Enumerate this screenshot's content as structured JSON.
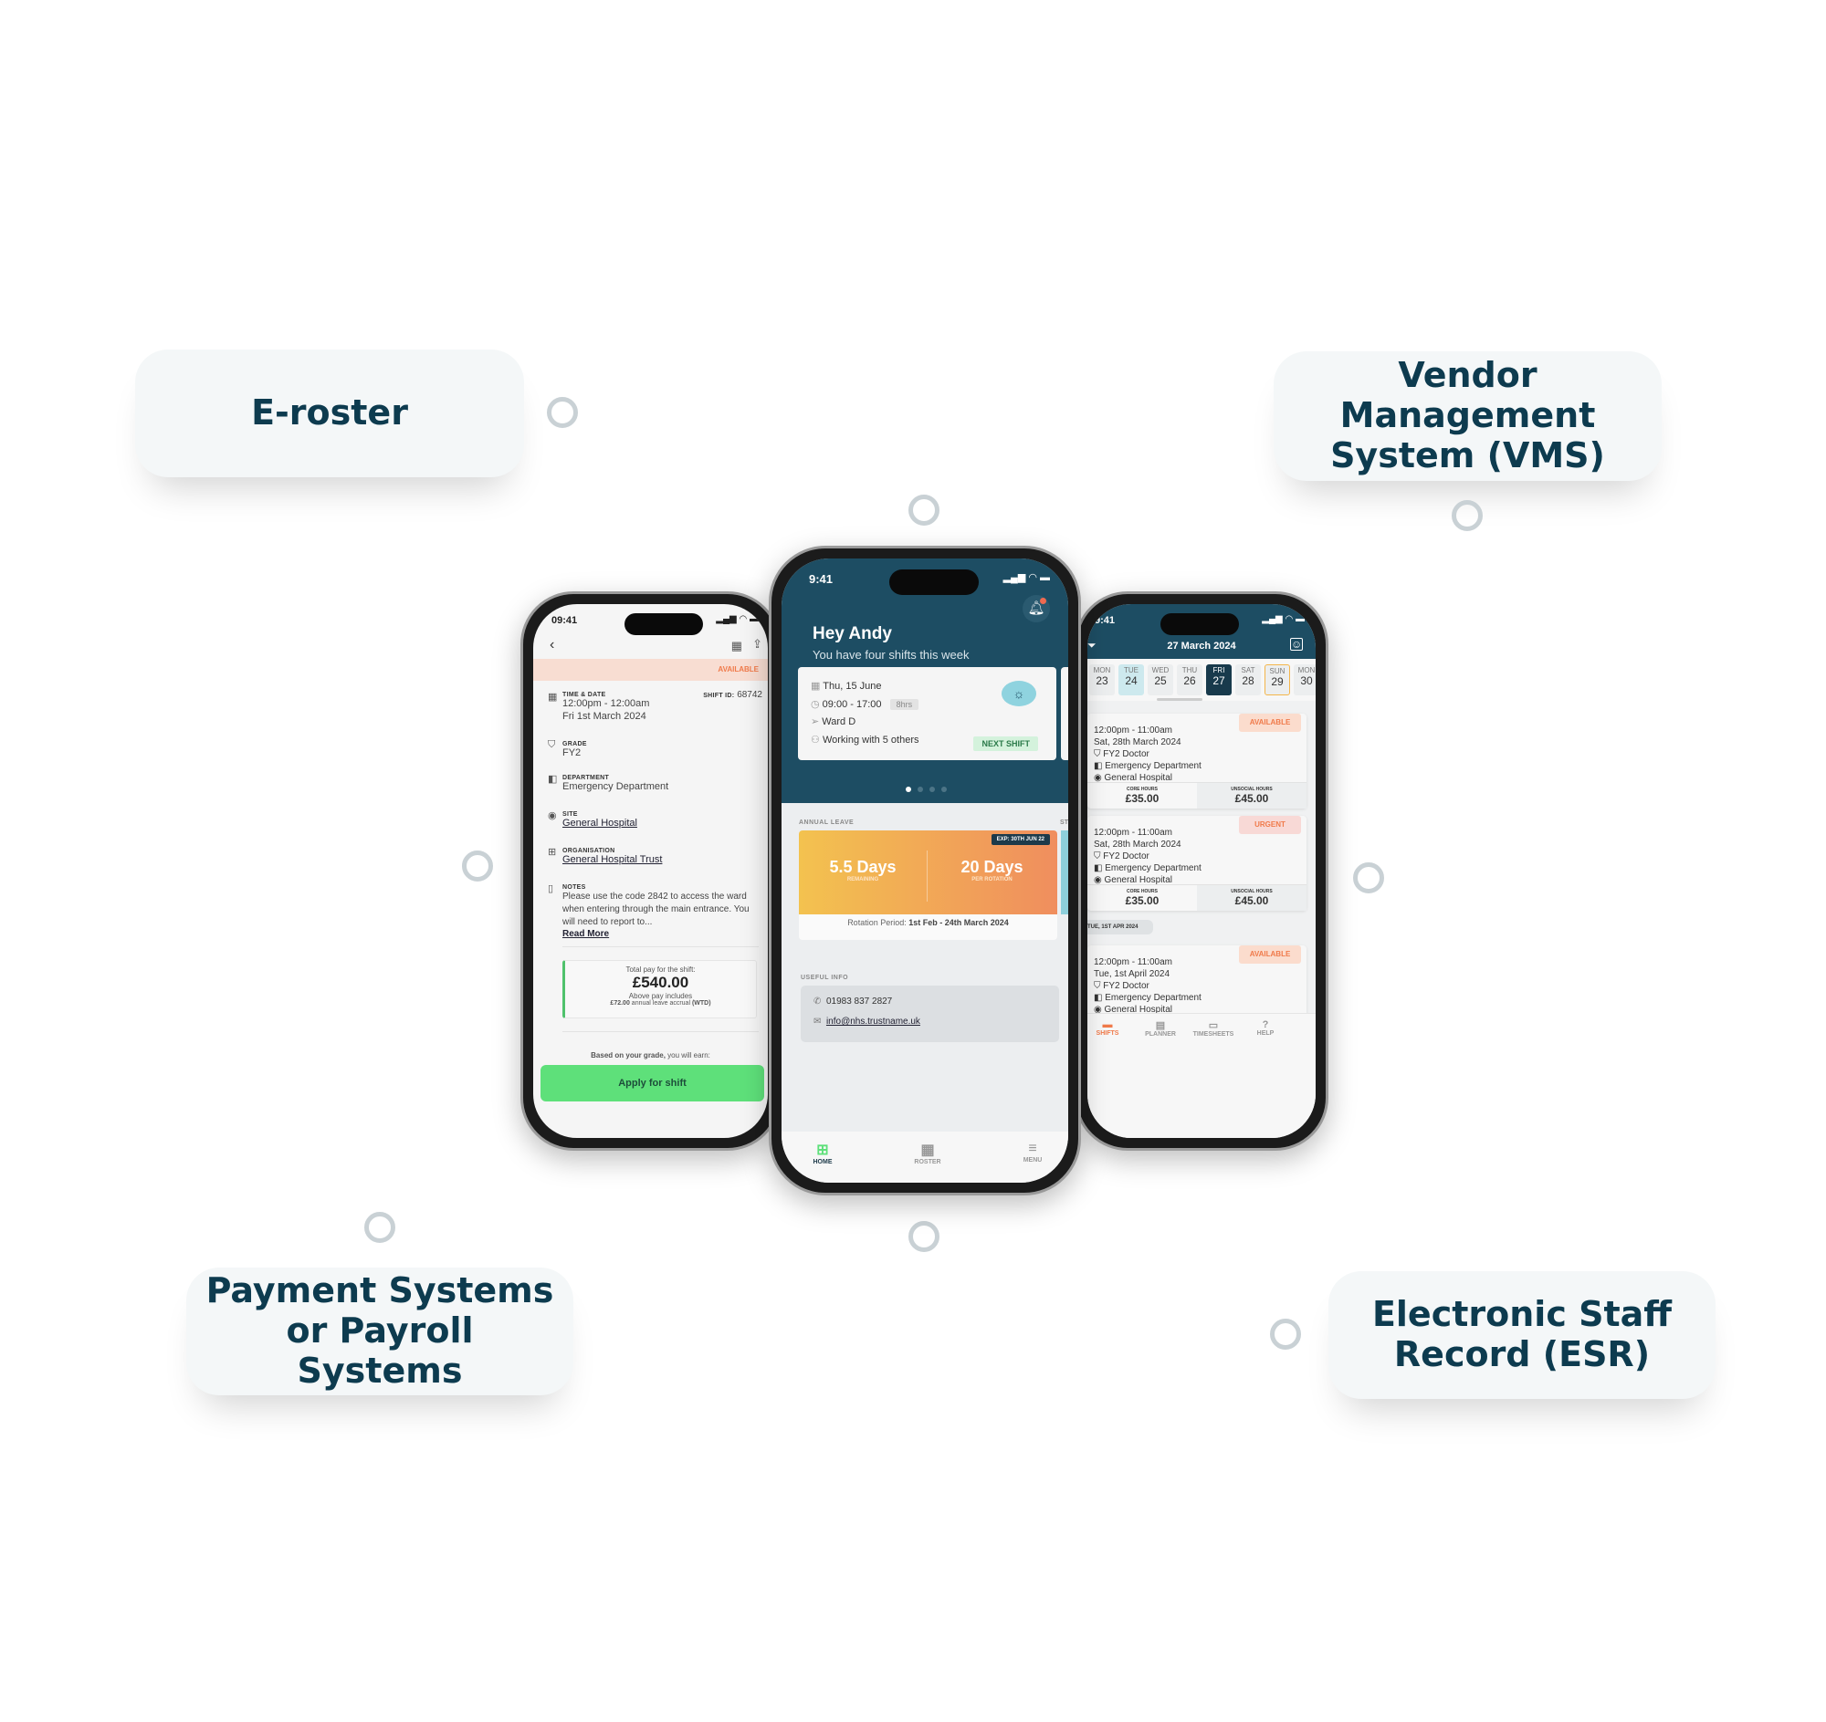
{
  "cards": {
    "eroster": "E-roster",
    "vms": "Vendor Management System (VMS)",
    "payment": "Payment Systems or Payroll Systems",
    "esr": "Electronic Staff Record (ESR)"
  },
  "colors": {
    "brand": "#0d3b4f",
    "header": "#1d4d63",
    "accent_green": "#5ee07a",
    "accent_orange": "#f07a4a"
  },
  "left_phone": {
    "time": "09:41",
    "status_badge": "AVAILABLE",
    "time_date_label": "TIME & DATE",
    "time_range": "12:00pm - 12:00am",
    "date": "Fri 1st March 2024",
    "shift_id_label": "SHIFT ID:",
    "shift_id": "68742",
    "grade_label": "GRADE",
    "grade": "FY2",
    "department_label": "DEPARTMENT",
    "department": "Emergency Department",
    "site_label": "SITE",
    "site": "General Hospital",
    "org_label": "ORGANISATION",
    "org": "General Hospital Trust",
    "notes_label": "NOTES",
    "notes": "Please use the code 2842 to access the ward when entering through the main entrance. You will need to report to...",
    "read_more": "Read More",
    "pay_title": "Total pay for the shift:",
    "pay_amount": "£540.00",
    "pay_includes": "Above pay includes",
    "pay_accrual_amount": "£72.00",
    "pay_accrual_text": "annual leave accrual",
    "pay_wtd": "(WTD)",
    "grade_earn_bold": "Based on your grade,",
    "grade_earn_rest": "you will earn:",
    "apply_button": "Apply for shift"
  },
  "center_phone": {
    "time": "9:41",
    "greeting": "Hey Andy",
    "subtitle": "You have four shifts this week",
    "next_shift": {
      "date": "Thu, 15 June",
      "time": "09:00 - 17:00",
      "duration": "8hrs",
      "ward": "Ward D",
      "team": "Working with 5 others",
      "badge": "NEXT SHIFT"
    },
    "carousel_pages": 4,
    "carousel_active": 1,
    "annual_leave_label": "ANNUAL LEAVE",
    "next_section_label": "ST",
    "leave": {
      "expiry": "EXP: 30TH JUN 22",
      "remaining": "5.5 Days",
      "remaining_label": "REMAINING",
      "per_rotation": "20 Days",
      "per_rotation_label": "PER ROTATION",
      "rotation_label": "Rotation Period:",
      "rotation_value": "1st Feb - 24th March 2024"
    },
    "useful_info_label": "USEFUL INFO",
    "phone": "01983 837 2827",
    "email": "info@nhs.trustname.uk",
    "nav": [
      {
        "label": "HOME",
        "active": true
      },
      {
        "label": "ROSTER",
        "active": false
      },
      {
        "label": "MENU",
        "active": false
      }
    ],
    "roster_icon_day": "15"
  },
  "right_phone": {
    "time": "9:41",
    "title": "27 March 2024",
    "days": [
      {
        "d": "MON",
        "n": "23"
      },
      {
        "d": "TUE",
        "n": "24"
      },
      {
        "d": "WED",
        "n": "25"
      },
      {
        "d": "THU",
        "n": "26"
      },
      {
        "d": "FRI",
        "n": "27"
      },
      {
        "d": "SAT",
        "n": "28"
      },
      {
        "d": "SUN",
        "n": "29"
      },
      {
        "d": "MON",
        "n": "30"
      }
    ],
    "shifts": [
      {
        "time": "12:00pm - 11:00am",
        "date": "Sat, 28th March 2024",
        "grade": "FY2 Doctor",
        "dept": "Emergency Department",
        "site": "General Hospital",
        "badge": "AVAILABLE",
        "core_label": "CORE HOURS",
        "core": "£35.00",
        "unsocial_label": "UNSOCIAL HOURS",
        "unsocial": "£45.00"
      },
      {
        "time": "12:00pm - 11:00am",
        "date": "Sat, 28th March 2024",
        "grade": "FY2 Doctor",
        "dept": "Emergency Department",
        "site": "General Hospital",
        "badge": "URGENT",
        "core_label": "CORE HOURS",
        "core": "£35.00",
        "unsocial_label": "UNSOCIAL HOURS",
        "unsocial": "£45.00"
      },
      {
        "time": "12:00pm - 11:00am",
        "date": "Tue, 1st April 2024",
        "grade": "FY2 Doctor",
        "dept": "Emergency Department",
        "site": "General Hospital",
        "badge": "AVAILABLE"
      }
    ],
    "date_chip": "TUE, 1ST APR 2024",
    "nav": [
      {
        "label": "SHIFTS",
        "active": true
      },
      {
        "label": "PLANNER"
      },
      {
        "label": "TIMESHEETS"
      },
      {
        "label": "HELP"
      }
    ]
  }
}
